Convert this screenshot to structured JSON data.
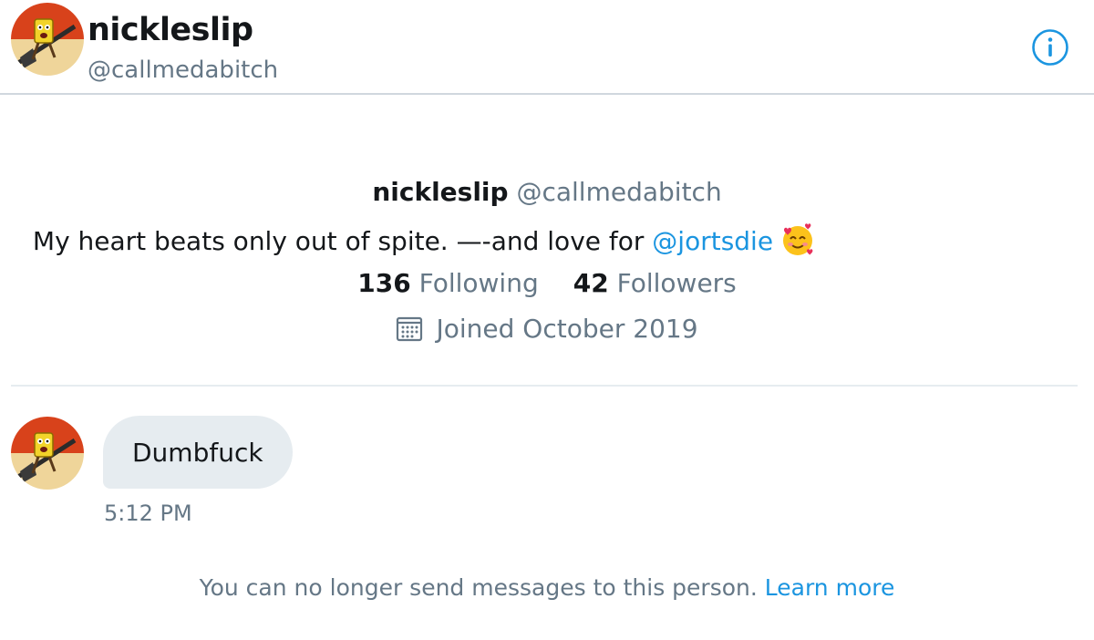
{
  "header": {
    "name": "nickleslip",
    "handle": "@callmedabitch",
    "info_icon": "info-icon"
  },
  "profile": {
    "name": "nickleslip",
    "handle": "@callmedabitch",
    "bio_text": "My heart beats only out of spite. —-and love for ",
    "bio_mention": "@jortsdie",
    "bio_emoji": "smiling-face-with-hearts",
    "following_count": "136",
    "following_label": "Following",
    "followers_count": "42",
    "followers_label": "Followers",
    "joined": "Joined October 2019",
    "joined_icon": "calendar-icon"
  },
  "messages": [
    {
      "text": "Dumbfuck",
      "time": "5:12 PM"
    }
  ],
  "notice": {
    "text": "You can no longer send messages to this person. ",
    "link": "Learn more"
  },
  "colors": {
    "accent": "#1b95e0",
    "secondary_text": "#657786",
    "bubble": "#e6ecf0",
    "primary_text": "#14171a"
  }
}
